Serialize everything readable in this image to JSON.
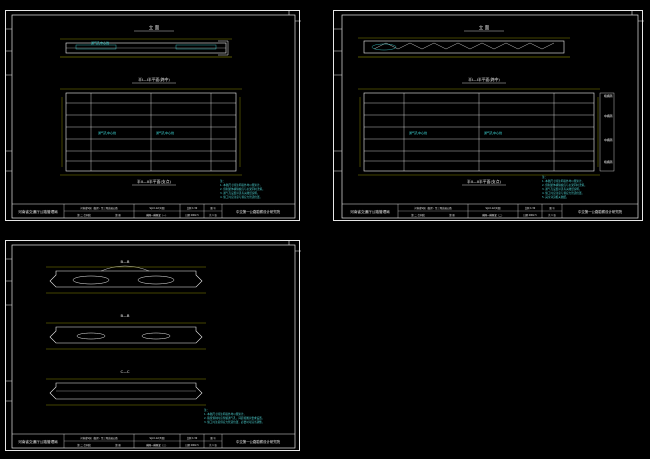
{
  "sheets": [
    {
      "org": "河南省交通厅公路管理局",
      "project_line1": "河南省S国（省界）至三零高速公路",
      "project_line2": "第 二 合同段",
      "project_line3": "第   册",
      "drawing_no": "SJ-IX-12(1)图",
      "drawing_title": "横隔一横隔梁（一）",
      "scale": "比例 1:30",
      "date": "日期 2002.5",
      "sheet_label": "图 号",
      "sheet_count": "共 1 张",
      "institute": "中交第一公路勘察设计研究院",
      "view_title_top": "立 面",
      "view_title_mid": "半I—I半平面(跨中)",
      "view_title_bot": "半II—II半平面(支点)",
      "annotations": [
        "通气孔中心线",
        "通气孔中心线",
        "通气孔中心线"
      ],
      "notes": [
        "注：",
        "1. 本图尺寸除注明者外均以厘米计。",
        "2. 预制梁体横隔板应与主梁同时浇筑。",
        "3. 通气孔设置详见有关图纸说明。",
        "4. 施工时应注意与预应力管道位置。"
      ]
    },
    {
      "org": "河南省交通厅公路管理局",
      "project_line1": "河南省S国（省界）至三零高速公路",
      "project_line2": "第 二 合同段",
      "project_line3": "第   册",
      "drawing_no": "SJ-IX-12(2)图",
      "drawing_title": "横隔一横隔梁（二）",
      "scale": "比例 1:30",
      "date": "日期 2002.5",
      "sheet_label": "图 号",
      "sheet_count": "共 1 张",
      "institute": "中交第一公路勘察设计研究院",
      "view_title_top": "立 面",
      "view_title_mid": "半I—I半平面(跨中)",
      "view_title_bot": "半II—II半平面(支点)",
      "side_labels": [
        "端横隔",
        "中横隔",
        "中横隔",
        "端横隔"
      ],
      "annotations": [
        "通气孔中心线",
        "通气孔中心线"
      ],
      "notes": [
        "注：",
        "1. 本图尺寸除注明者外均以厘米计。",
        "2. 预制梁体横隔板应与主梁同时浇筑。",
        "3. 通气孔设置详见有关图纸说明。",
        "4. 施工时应注意与预应力管道位置。",
        "5. 其余详见相关图纸。"
      ]
    },
    {
      "org": "河南省交通厅公路管理局",
      "project_line1": "河南省S国（省界）至三零高速公路",
      "project_line2": "第 二 合同段",
      "project_line3": "第   册",
      "drawing_no": "SJ-IX-12(3)图",
      "drawing_title": "横隔一横隔梁（三）",
      "scale": "比例 1:30",
      "date": "日期 2002.5",
      "sheet_label": "图 号",
      "sheet_count": "共 1 张",
      "institute": "中交第一公路勘察设计研究院",
      "section_titles": [
        "B—B",
        "B—B",
        "C—C"
      ],
      "notes": [
        "注：",
        "1. 本图尺寸除注明者外均以厘米计。",
        "2. 箱梁预制时应预留通气孔，间距按图示要求设置。",
        "3. 施工时注意预应力管道位置，必要时可适当调整。"
      ]
    }
  ],
  "colors": {
    "frame": "#e6e6e6",
    "drawing_line": "#f0f0f0",
    "note_text": "#4fd6d6",
    "hatch": "#3fd9d9",
    "yellow": "#e0e000"
  }
}
